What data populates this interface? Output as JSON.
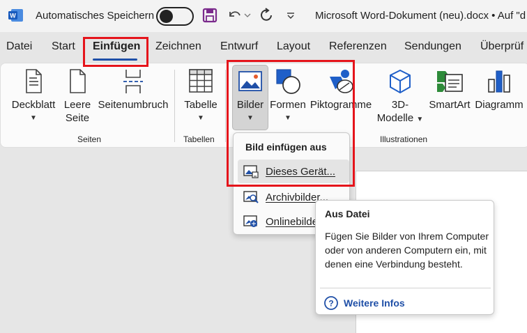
{
  "titlebar": {
    "autosave_label": "Automatisches Speichern",
    "document_title": "Microsoft Word-Dokument (neu).docx • Auf \"d"
  },
  "tabs": [
    "Datei",
    "Start",
    "Einfügen",
    "Zeichnen",
    "Entwurf",
    "Layout",
    "Referenzen",
    "Sendungen",
    "Überprüf"
  ],
  "active_tab": "Einfügen",
  "ribbon": {
    "deckblatt": "Deckblatt",
    "leere_seite_1": "Leere",
    "leere_seite_2": "Seite",
    "seitenumbruch": "Seitenumbruch",
    "tabelle": "Tabelle",
    "bilder": "Bilder",
    "formen": "Formen",
    "piktogramme": "Piktogramme",
    "modelle_1": "3D-",
    "modelle_2": "Modelle",
    "smartart": "SmartArt",
    "diagramm": "Diagramm",
    "groups": {
      "seiten": "Seiten",
      "tabellen": "Tabellen",
      "illustrationen": "Illustrationen"
    }
  },
  "dropdown": {
    "header": "Bild einfügen aus",
    "items": [
      "Dieses Gerät...",
      "Archivbilder...",
      "Onlinebilde"
    ]
  },
  "tooltip": {
    "title": "Aus Datei",
    "body": "Fügen Sie Bilder von Ihrem Computer oder von anderen Computern ein, mit denen eine Verbindung besteht.",
    "more_link": "Weitere Infos"
  },
  "colors": {
    "accent_blue": "#1f4fa7",
    "highlight_red": "#e5141b",
    "word_blue": "#185abd",
    "save_purple": "#7b2a8c"
  }
}
